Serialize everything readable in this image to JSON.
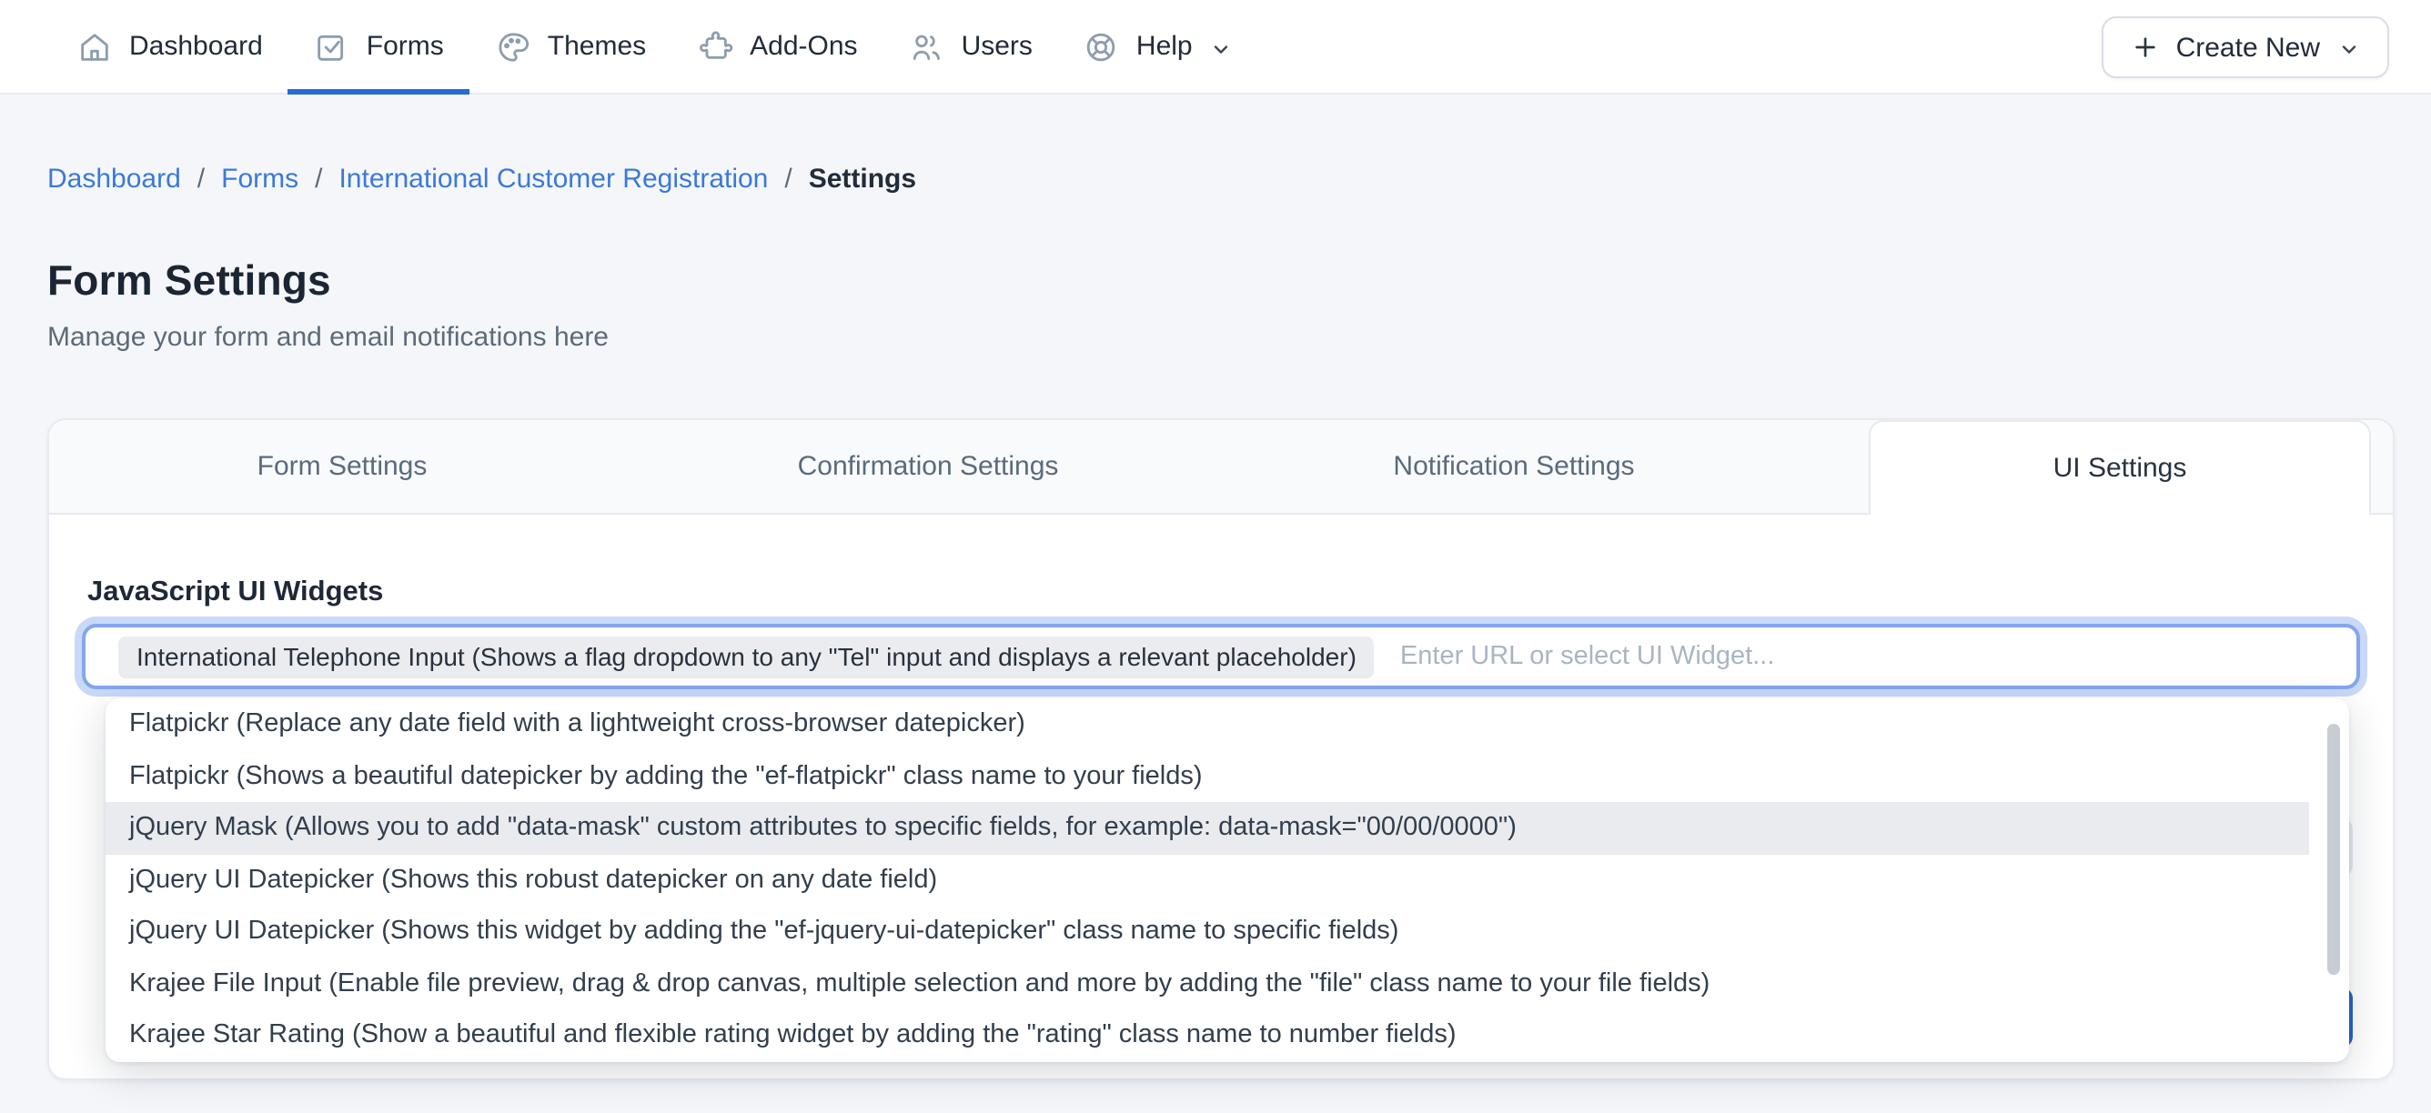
{
  "nav": {
    "items": [
      {
        "label": "Dashboard",
        "icon": "home-icon",
        "active": false
      },
      {
        "label": "Forms",
        "icon": "checkbox-icon",
        "active": true
      },
      {
        "label": "Themes",
        "icon": "palette-icon",
        "active": false
      },
      {
        "label": "Add-Ons",
        "icon": "puzzle-icon",
        "active": false
      },
      {
        "label": "Users",
        "icon": "users-icon",
        "active": false
      },
      {
        "label": "Help",
        "icon": "lifebuoy-icon",
        "active": false,
        "has_dropdown": true
      }
    ],
    "create_new_label": "Create New"
  },
  "breadcrumb": {
    "separator": "/",
    "items": [
      "Dashboard",
      "Forms",
      "International Customer Registration"
    ],
    "current": "Settings"
  },
  "page": {
    "title": "Form Settings",
    "subtitle": "Manage your form and email notifications here"
  },
  "tabs": [
    {
      "label": "Form Settings",
      "active": false
    },
    {
      "label": "Confirmation Settings",
      "active": false
    },
    {
      "label": "Notification Settings",
      "active": false
    },
    {
      "label": "UI Settings",
      "active": true
    }
  ],
  "ui_settings": {
    "widgets_label": "JavaScript UI Widgets",
    "selected_widget": "International Telephone Input (Shows a flag dropdown to any \"Tel\" input and displays a relevant placeholder)",
    "input_placeholder": "Enter URL or select UI Widget...",
    "dropdown_options": [
      {
        "label": "Flatpickr (Replace any date field with a lightweight cross-browser datepicker)",
        "highlighted": false
      },
      {
        "label": "Flatpickr (Shows a beautiful datepicker by adding the \"ef-flatpickr\" class name to your fields)",
        "highlighted": false
      },
      {
        "label": "jQuery Mask (Allows you to add \"data-mask\" custom attributes to specific fields, for example: data-mask=\"00/00/0000\")",
        "highlighted": true
      },
      {
        "label": "jQuery UI Datepicker (Shows this robust datepicker on any date field)",
        "highlighted": false
      },
      {
        "label": "jQuery UI Datepicker (Shows this widget by adding the \"ef-jquery-ui-datepicker\" class name to specific fields)",
        "highlighted": false
      },
      {
        "label": "Krajee File Input (Enable file preview, drag & drop canvas, multiple selection and more by adding the \"file\" class name to your file fields)",
        "highlighted": false
      },
      {
        "label": "Krajee Star Rating (Show a beautiful and flexible rating widget by adding the \"rating\" class name to number fields)",
        "highlighted": false
      }
    ]
  },
  "colors": {
    "accent_blue": "#2a6bd2",
    "breadcrumb_link": "#3b79d8",
    "primary_button": "#2b63c6",
    "focus_ring": "#93b4f3",
    "highlight_row": "#e9ebef",
    "page_background": "#f4f6f9"
  }
}
